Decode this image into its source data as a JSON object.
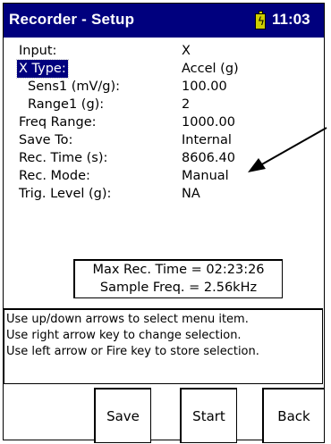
{
  "titlebar": {
    "title": "Recorder - Setup",
    "time": "11:03",
    "battery_icon": "battery-charging-icon",
    "color": "#00007e"
  },
  "settings": [
    {
      "label": "Input:",
      "value": "X",
      "indent": false,
      "selected": false
    },
    {
      "label": "X Type:",
      "value": "Accel (g)",
      "indent": false,
      "selected": true
    },
    {
      "label": "Sens1 (mV/g):",
      "value": "100.00",
      "indent": true,
      "selected": false
    },
    {
      "label": "Range1 (g):",
      "value": "2",
      "indent": true,
      "selected": false
    },
    {
      "label": "Freq Range:",
      "value": "1000.00",
      "indent": false,
      "selected": false
    },
    {
      "label": "Save To:",
      "value": "Internal",
      "indent": false,
      "selected": false
    },
    {
      "label": "Rec. Time (s):",
      "value": "8606.40",
      "indent": false,
      "selected": false
    },
    {
      "label": "Rec. Mode:",
      "value": "Manual",
      "indent": false,
      "selected": false
    },
    {
      "label": "Trig. Level (g):",
      "value": "NA",
      "indent": false,
      "selected": false
    }
  ],
  "info": {
    "max_rec_time": "Max Rec. Time = 02:23:26",
    "sample_freq": "Sample Freq. = 2.56kHz"
  },
  "help": [
    "Use up/down arrows to select menu item.",
    "Use right arrow key to change selection.",
    "Use left arrow or Fire key to store selection."
  ],
  "buttons": {
    "save": "Save",
    "start": "Start",
    "back": "Back"
  },
  "annotation_icon": "arrow-pointer-icon"
}
